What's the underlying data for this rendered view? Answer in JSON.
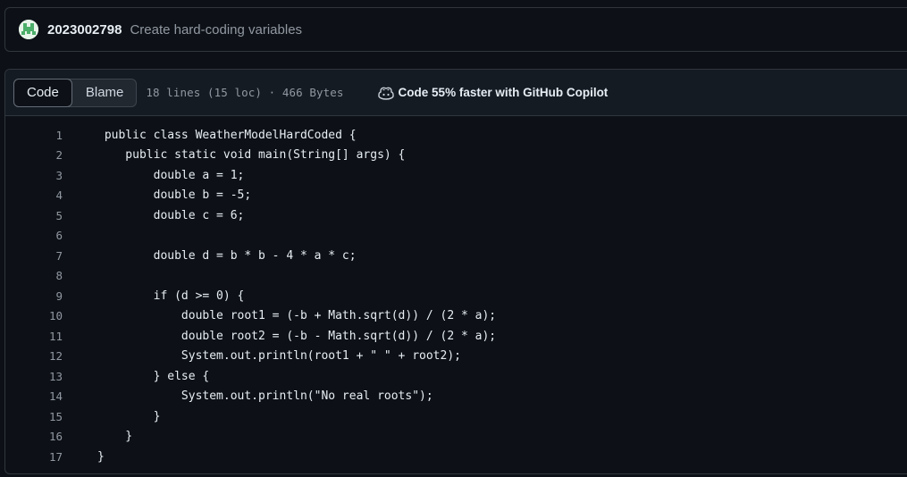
{
  "commit": {
    "author": "2023002798",
    "message": "Create hard-coding variables",
    "avatar_icon": "identicon-avatar"
  },
  "file_header": {
    "tabs": [
      {
        "label": "Code",
        "active": true
      },
      {
        "label": "Blame",
        "active": false
      }
    ],
    "meta": "18 lines (15 loc) · 466 Bytes",
    "copilot_label": "Code 55% faster with GitHub Copilot",
    "copilot_icon": "copilot-icon"
  },
  "code": {
    "lines": [
      {
        "n": "1",
        "text": " public class WeatherModelHardCoded {"
      },
      {
        "n": "2",
        "text": "    public static void main(String[] args) {"
      },
      {
        "n": "3",
        "text": "        double a = 1;"
      },
      {
        "n": "4",
        "text": "        double b = -5;"
      },
      {
        "n": "5",
        "text": "        double c = 6;"
      },
      {
        "n": "6",
        "text": ""
      },
      {
        "n": "7",
        "text": "        double d = b * b - 4 * a * c;"
      },
      {
        "n": "8",
        "text": ""
      },
      {
        "n": "9",
        "text": "        if (d >= 0) {"
      },
      {
        "n": "10",
        "text": "            double root1 = (-b + Math.sqrt(d)) / (2 * a);"
      },
      {
        "n": "11",
        "text": "            double root2 = (-b - Math.sqrt(d)) / (2 * a);"
      },
      {
        "n": "12",
        "text": "            System.out.println(root1 + \" \" + root2);"
      },
      {
        "n": "13",
        "text": "        } else {"
      },
      {
        "n": "14",
        "text": "            System.out.println(\"No real roots\");"
      },
      {
        "n": "15",
        "text": "        }"
      },
      {
        "n": "16",
        "text": "    }"
      },
      {
        "n": "17",
        "text": "}"
      }
    ]
  }
}
